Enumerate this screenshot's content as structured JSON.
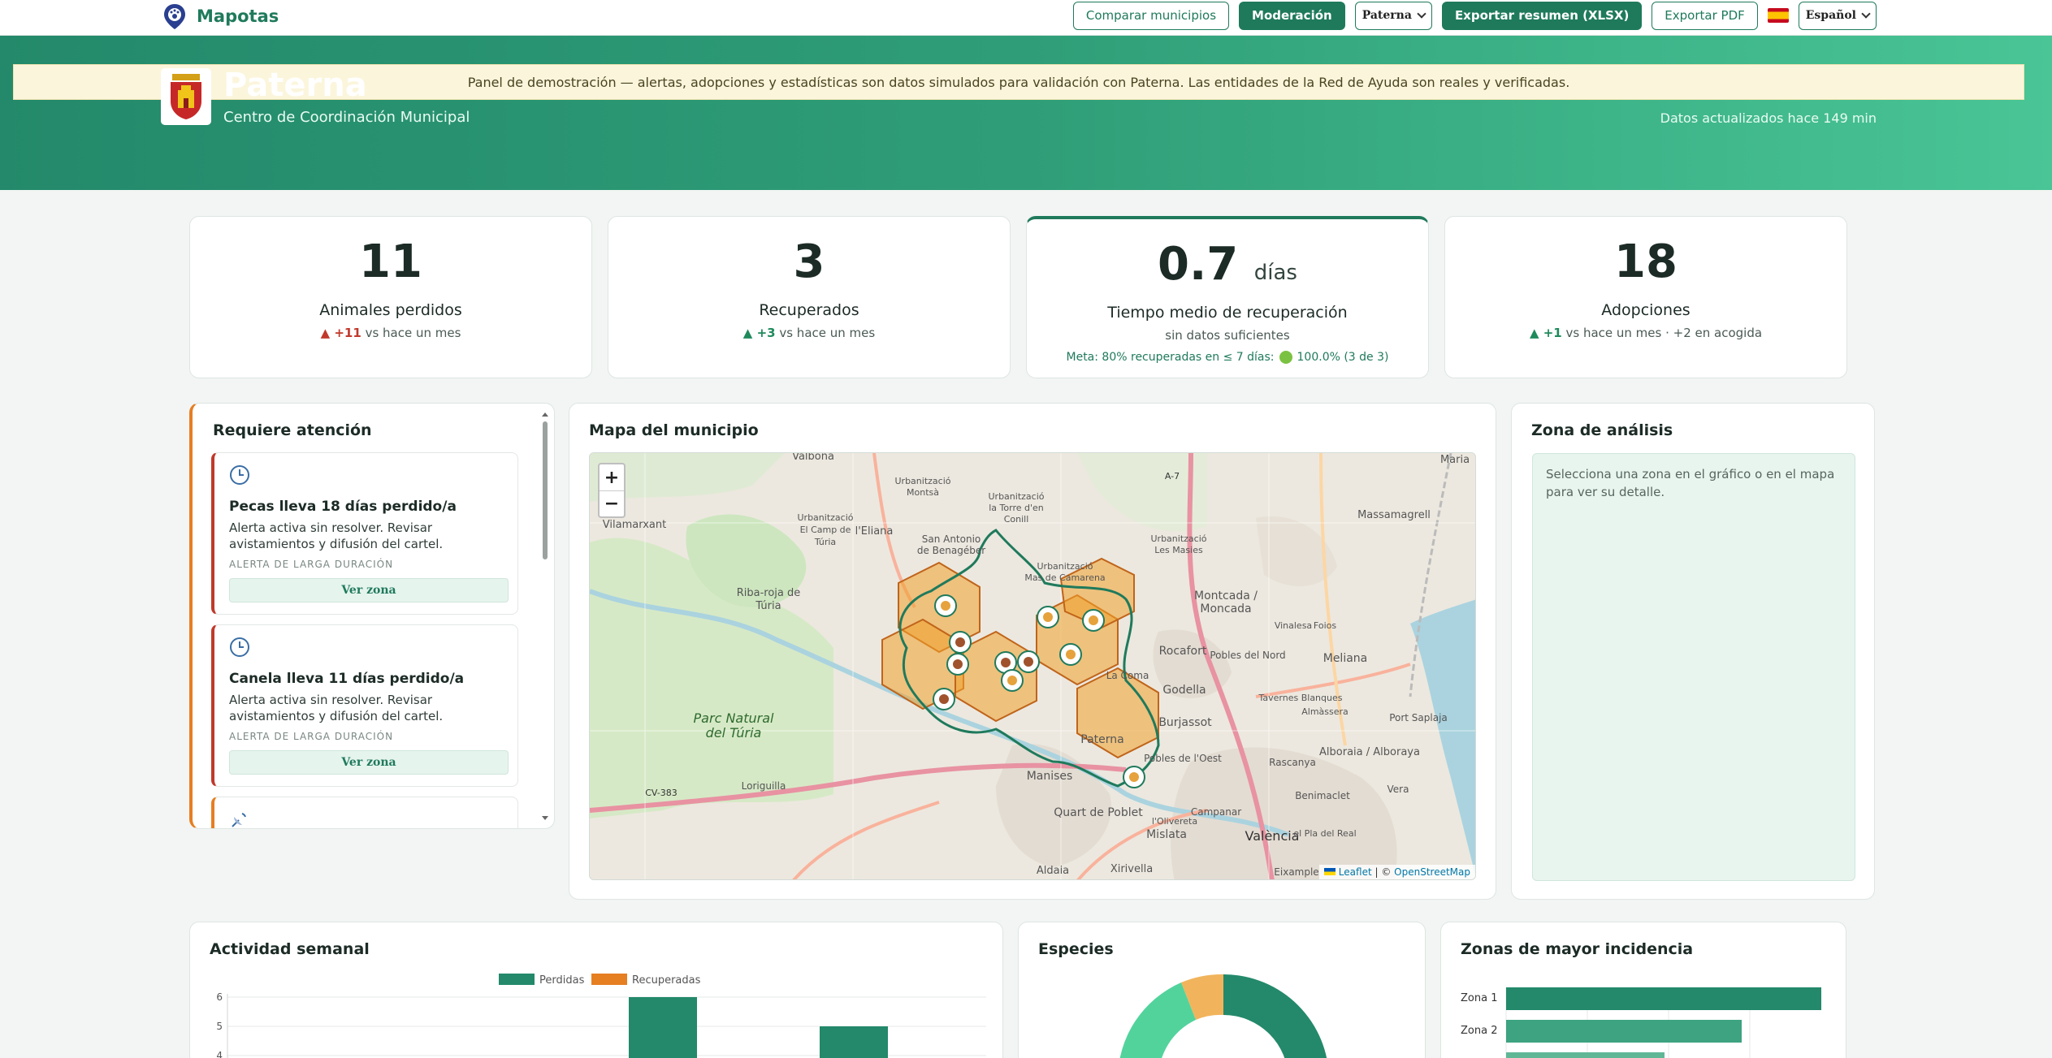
{
  "nav": {
    "brand": "Mapotas",
    "compare_label": "Comparar municipios",
    "moderation_label": "Moderación",
    "municipality_select": "Paterna",
    "export_xlsx_label": "Exportar resumen (XLSX)",
    "export_pdf_label": "Exportar PDF",
    "language_select": "Español"
  },
  "banner": "Panel de demostración — alertas, adopciones y estadísticas son datos simulados para validación con Paterna. Las entidades de la Red de Ayuda son reales y verificadas.",
  "hero": {
    "city": "Paterna",
    "subtitle": "Centro de Coordinación Municipal",
    "updated": "Datos actualizados hace 149 min"
  },
  "stats": {
    "lost": {
      "value": "11",
      "label": "Animales perdidos",
      "delta": "+11",
      "delta_suffix": " vs hace un mes"
    },
    "recovered": {
      "value": "3",
      "label": "Recuperados",
      "delta": "+3",
      "delta_suffix": " vs hace un mes"
    },
    "recovery_time": {
      "value": "0.7",
      "unit": "días",
      "label": "Tiempo medio de recuperación",
      "note": "sin datos suficientes",
      "goal_prefix": "Meta: 80% recuperadas en ≤ 7 días:",
      "goal_value": "100.0% (3 de 3)"
    },
    "adoptions": {
      "value": "18",
      "label": "Adopciones",
      "delta": "+1",
      "delta_suffix": " vs hace un mes · +2 en acogida"
    }
  },
  "attention": {
    "title": "Requiere atención",
    "alerts": [
      {
        "title": "Pecas lleva 18 días perdido/a",
        "desc": "Alerta activa sin resolver. Revisar avistamientos y difusión del cartel.",
        "tag": "ALERTA DE LARGA DURACIÓN",
        "button": "Ver zona"
      },
      {
        "title": "Canela lleva 11 días perdido/a",
        "desc": "Alerta activa sin resolver. Revisar avistamientos y difusión del cartel.",
        "tag": "ALERTA DE LARGA DURACIÓN",
        "button": "Ver zona"
      }
    ]
  },
  "map": {
    "title": "Mapa del municipio",
    "attribution_leaflet": "Leaflet",
    "attribution_osm": "OpenStreetMap",
    "places": {
      "valbona": "Valbona",
      "vilamarxant": "Vilamarxant",
      "parc1": "Parc Natural",
      "parc2": "del Túria",
      "riba1": "Riba-roja de",
      "riba2": "Túria",
      "elcamp1": "Urbanització",
      "elcamp2": "El Camp de",
      "elcamp3": "Túria",
      "eliana": "l'Eliana",
      "sanantonio1": "San Antonio",
      "sanantonio2": "de Benagéber",
      "montsa1": "Urbanització",
      "montsa2": "Montsà",
      "torre1": "Urbanització",
      "torre2": "la Torre d'en",
      "torre3": "Conill",
      "masies1": "Urbanització",
      "masies2": "Les Masies",
      "mas1": "Urbanització",
      "mas2": "Mas de Camarena",
      "moncada1": "Montcada /",
      "moncada2": "Moncada",
      "rocafort": "Rocafort",
      "godella": "Godella",
      "burjassot": "Burjassot",
      "paterna": "Paterna",
      "manises": "Manises",
      "quart": "Quart de Poblet",
      "mislata": "Mislata",
      "valencia": "València",
      "aldaia": "Aldaia",
      "xirivella": "Xirivella",
      "loriguilla": "Loriguilla",
      "meliana": "Meliana",
      "alboraia": "Alboraia / Alboraya",
      "massamagrell": "Massamagrell",
      "maria": "Maria",
      "campanar": "Campanar",
      "benimaclet": "Benimaclet",
      "portsaplaja": "Port Saplaja",
      "lacoma": "La Coma",
      "cv383": "CV-383",
      "a7": "A-7",
      "vera": "Vera",
      "eixample": "Eixample",
      "poblesnord": "Pobles del Nord",
      "poblesoest": "Pobles de l'Oest",
      "vinalesa": "Vinalesa",
      "foios": "Foios",
      "rascanya": "Rascanya",
      "tavernes": "Tavernes Blanques",
      "almassera": "Almàssera",
      "olivereta": "l'Olivereta",
      "elpla": "el Pla del Real"
    }
  },
  "zone": {
    "title": "Zona de análisis",
    "hint": "Selecciona una zona en el gráfico o en el mapa para ver su detalle."
  },
  "weekly": {
    "title": "Actividad semanal",
    "chart_data": {
      "type": "bar",
      "series": [
        {
          "name": "Perdidas",
          "color": "#23896a"
        },
        {
          "name": "Recuperadas",
          "color": "#e67e22"
        }
      ],
      "y_ticks": [
        "6",
        "5",
        "4"
      ]
    }
  },
  "species": {
    "title": "Especies"
  },
  "zones_chart": {
    "title": "Zonas de mayor incidencia",
    "chart_data": {
      "type": "bar",
      "categories": [
        "Zona 1",
        "Zona 2"
      ]
    }
  }
}
